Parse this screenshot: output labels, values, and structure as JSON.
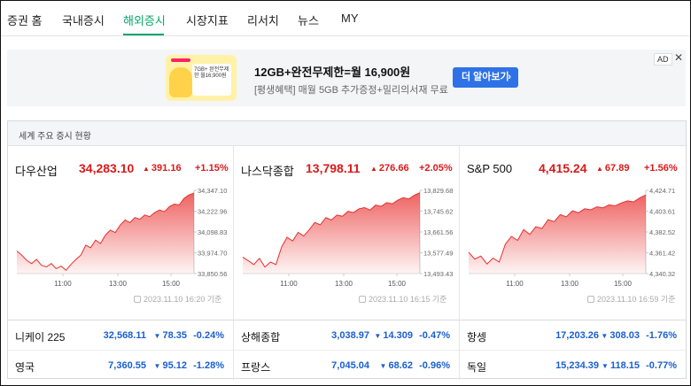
{
  "nav": {
    "items": [
      {
        "label": "증권 홈"
      },
      {
        "label": "국내증시"
      },
      {
        "label": "해외증시",
        "active": true
      },
      {
        "label": "시장지표"
      },
      {
        "label": "리서치"
      },
      {
        "label": "뉴스"
      },
      {
        "label": "MY"
      }
    ]
  },
  "ad": {
    "image_text": "7GB+ 완전무제한 월16,900원",
    "title": "12GB+완전무제한=월 16,900원",
    "subtitle": "[평생혜택] 매월 5GB 추가증정+밀리의서재 무료",
    "button_label": "더 알아보기",
    "button_chevron": "›",
    "badge": "AD",
    "close": "✕",
    "colors": {
      "button": "#2f72e8",
      "background": "#f4f5f7"
    }
  },
  "panel": {
    "title": "세계 주요 증시 현황"
  },
  "cards": [
    {
      "name": "다우산업",
      "value": "34,283.10",
      "change_arrow": "▲",
      "change": "391.16",
      "percent": "+1.15%",
      "timestamp": "2023.11.10 16:20 기준",
      "chart_data": {
        "type": "area",
        "x_ticks": [
          "11:00",
          "13:00",
          "15:00"
        ],
        "y_ticks": [
          "34,347.10",
          "34,222.96",
          "34,098.83",
          "33,974.70",
          "33,850.56"
        ],
        "ylim": [
          33850.56,
          34347.1
        ],
        "values": [
          33985,
          33960,
          33930,
          33910,
          33935,
          33900,
          33890,
          33910,
          33880,
          33895,
          33870,
          33905,
          33935,
          33960,
          34020,
          34005,
          34050,
          34030,
          34080,
          34110,
          34095,
          34140,
          34170,
          34155,
          34185,
          34175,
          34200,
          34190,
          34215,
          34230,
          34220,
          34250,
          34265,
          34260,
          34300,
          34320,
          34330
        ],
        "color": "#e8302e"
      }
    },
    {
      "name": "나스닥종합",
      "value": "13,798.11",
      "change_arrow": "▲",
      "change": "276.66",
      "percent": "+2.05%",
      "timestamp": "2023.11.10 16:15 기준",
      "chart_data": {
        "type": "area",
        "x_ticks": [
          "11:00",
          "13:00",
          "15:00"
        ],
        "y_ticks": [
          "13,829.68",
          "13,745.62",
          "13,661.56",
          "13,577.49",
          "13,493.43"
        ],
        "ylim": [
          13493.43,
          13829.68
        ],
        "values": [
          13560,
          13545,
          13530,
          13555,
          13520,
          13540,
          13530,
          13600,
          13640,
          13625,
          13660,
          13645,
          13670,
          13700,
          13690,
          13720,
          13710,
          13730,
          13725,
          13745,
          13740,
          13755,
          13760,
          13750,
          13770,
          13765,
          13780,
          13775,
          13790,
          13800,
          13795,
          13810,
          13820
        ],
        "color": "#e8302e"
      }
    },
    {
      "name": "S&P 500",
      "value": "4,415.24",
      "change_arrow": "▲",
      "change": "67.89",
      "percent": "+1.56%",
      "timestamp": "2023.11.10 16:59 기준",
      "chart_data": {
        "type": "area",
        "x_ticks": [
          "11:00",
          "13:00",
          "15:00"
        ],
        "y_ticks": [
          "4,424.71",
          "4,403.61",
          "4,382.52",
          "4,361.42",
          "4,340.32"
        ],
        "ylim": [
          4340.32,
          4424.71
        ],
        "values": [
          4362,
          4355,
          4358,
          4350,
          4356,
          4352,
          4370,
          4378,
          4374,
          4385,
          4380,
          4388,
          4386,
          4395,
          4393,
          4400,
          4398,
          4404,
          4402,
          4406,
          4405,
          4408,
          4407,
          4410,
          4409,
          4412,
          4414,
          4413,
          4417,
          4420
        ],
        "color": "#e8302e"
      }
    }
  ],
  "table": [
    [
      {
        "name": "니케이 225",
        "value": "32,568.11",
        "arrow": "▼",
        "change": "78.35",
        "percent": "-0.24%"
      },
      {
        "name": "상해종합",
        "value": "3,038.97",
        "arrow": "▼",
        "change": "14.309",
        "percent": "-0.47%"
      },
      {
        "name": "항셍",
        "value": "17,203.26",
        "arrow": "▼",
        "change": "308.03",
        "percent": "-1.76%"
      }
    ],
    [
      {
        "name": "영국",
        "value": "7,360.55",
        "arrow": "▼",
        "change": "95.12",
        "percent": "-1.28%"
      },
      {
        "name": "프랑스",
        "value": "7,045.04",
        "arrow": "▼",
        "change": "68.62",
        "percent": "-0.96%"
      },
      {
        "name": "독일",
        "value": "15,234.39",
        "arrow": "▼",
        "change": "118.15",
        "percent": "-0.77%"
      }
    ]
  ],
  "colors": {
    "up": "#d91a1a",
    "down": "#1a5fd0",
    "accent": "#03a56b"
  }
}
